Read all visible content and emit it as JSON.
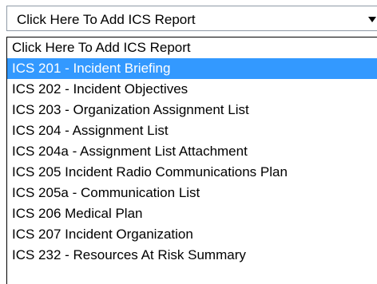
{
  "select": {
    "value": "Click Here To Add ICS Report",
    "arrow_icon": "chevron-down-icon"
  },
  "options": [
    {
      "label": "Click Here To Add ICS Report",
      "selected": false
    },
    {
      "label": "ICS 201 - Incident Briefing",
      "selected": true
    },
    {
      "label": "ICS 202 - Incident Objectives",
      "selected": false
    },
    {
      "label": "ICS 203 - Organization Assignment List",
      "selected": false
    },
    {
      "label": "ICS 204 - Assignment List",
      "selected": false
    },
    {
      "label": "ICS 204a - Assignment List Attachment",
      "selected": false
    },
    {
      "label": "ICS 205 Incident Radio Communications Plan",
      "selected": false
    },
    {
      "label": "ICS 205a - Communication List",
      "selected": false
    },
    {
      "label": "ICS 206 Medical Plan",
      "selected": false
    },
    {
      "label": "ICS 207 Incident Organization",
      "selected": false
    },
    {
      "label": "ICS 232 - Resources At Risk Summary",
      "selected": false
    }
  ],
  "colors": {
    "highlight": "#3399ff",
    "highlight_text": "#ffffff"
  }
}
